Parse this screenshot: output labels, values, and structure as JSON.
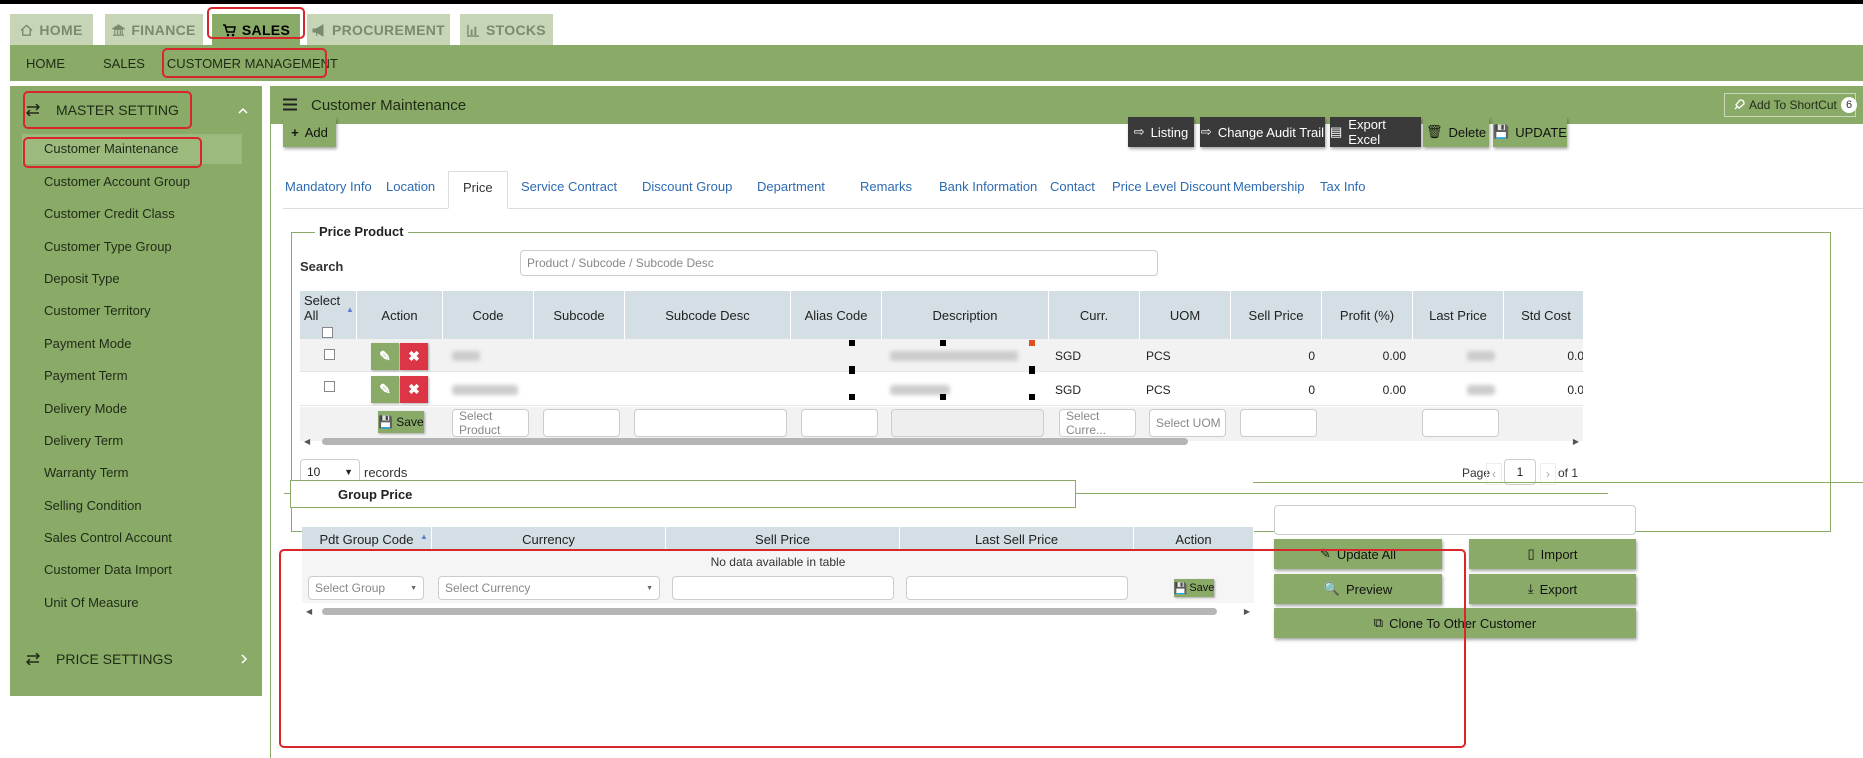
{
  "main_tabs": [
    {
      "label": "HOME",
      "icon": "home-icon"
    },
    {
      "label": "FINANCE",
      "icon": "bank-icon"
    },
    {
      "label": "SALES",
      "icon": "cart-icon"
    },
    {
      "label": "PROCUREMENT",
      "icon": "bullhorn-icon"
    },
    {
      "label": "STOCKS",
      "icon": "bar-chart-icon"
    }
  ],
  "sub_nav": [
    "HOME",
    "SALES",
    "CUSTOMER MANAGEMENT"
  ],
  "sidebar": {
    "master_setting": "MASTER SETTING",
    "items": [
      "Customer Maintenance",
      "Customer Account Group",
      "Customer Credit Class",
      "Customer Type Group",
      "Deposit Type",
      "Customer Territory",
      "Payment Mode",
      "Payment Term",
      "Delivery Mode",
      "Delivery Term",
      "Warranty Term",
      "Selling Condition",
      "Sales Control Account",
      "Customer Data Import",
      "Unit Of Measure"
    ],
    "price_settings": "PRICE SETTINGS"
  },
  "page": {
    "title": "Customer Maintenance",
    "shortcut_label": "Add To ShortCut",
    "shortcut_count": "6"
  },
  "toolbar": {
    "add": "Add",
    "listing": "Listing",
    "audit": "Change Audit Trail",
    "excel": "Export Excel",
    "delete": "Delete",
    "update": "UPDATE"
  },
  "tabs": [
    "Mandatory Info",
    "Location",
    "Price",
    "Service Contract",
    "Discount Group",
    "Department",
    "Remarks",
    "Bank Information",
    "Contact",
    "Price Level Discount",
    "Membership",
    "Tax Info"
  ],
  "price_product": {
    "legend": "Price Product",
    "search_label": "Search",
    "search_placeholder": "Product / Subcode / Subcode Desc",
    "select_all": "Select All",
    "columns": [
      "Action",
      "Code",
      "Subcode",
      "Subcode Desc",
      "Alias Code",
      "Description",
      "Curr.",
      "UOM",
      "Sell Price",
      "Profit (%)",
      "Last Price",
      "Std Cost"
    ],
    "rows": [
      {
        "curr": "SGD",
        "uom": "PCS",
        "sell": "0",
        "profit": "0.00",
        "std": "0.0"
      },
      {
        "curr": "SGD",
        "uom": "PCS",
        "sell": "0",
        "profit": "0.00",
        "std": "0.0"
      }
    ],
    "save": "Save",
    "select_product": "Select Product",
    "select_currency": "Select Curre...",
    "select_uom": "Select UOM",
    "page_size": "10",
    "records_label": "records",
    "page_label": "Page",
    "page_num": "1",
    "of_label": "of 1"
  },
  "group_price": {
    "legend": "Group Price",
    "columns": [
      "Pdt Group Code",
      "Currency",
      "Sell Price",
      "Last Sell Price",
      "Action"
    ],
    "empty": "No data available in table",
    "select_group": "Select Group",
    "select_currency": "Select Currency",
    "save": "Save"
  },
  "side_actions": {
    "update_all": "Update All",
    "import": "Import",
    "preview": "Preview",
    "export": "Export",
    "clone": "Clone To Other Customer"
  },
  "colors": {
    "accent": "#8aab68",
    "danger": "#dc3545",
    "highlight": "#d9262b",
    "dark": "#3a3a3a"
  }
}
